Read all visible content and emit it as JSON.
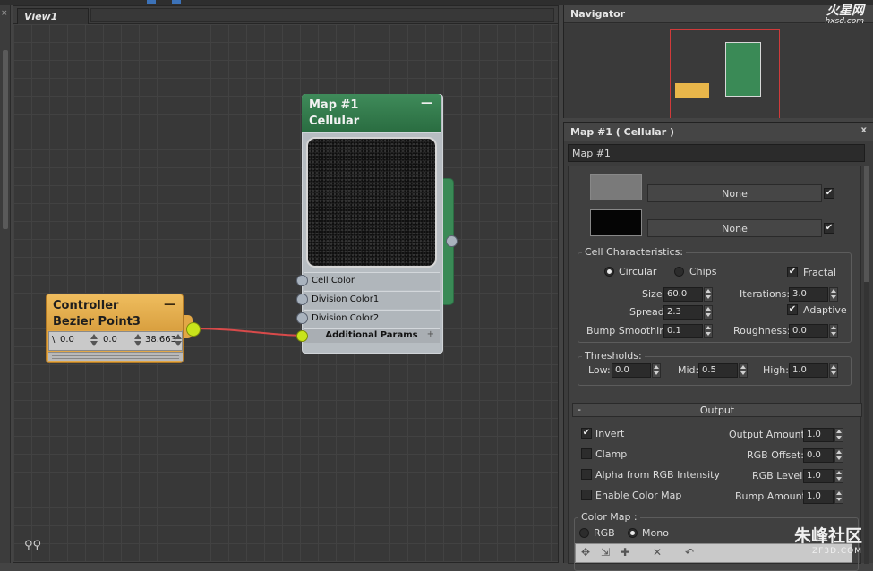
{
  "viewport": {
    "tab_label": "View1"
  },
  "controller_node": {
    "title_line1": "Controller",
    "title_line2": "Bezier Point3",
    "minimize": "—",
    "values": [
      "0.0",
      "0.0",
      "38.663"
    ]
  },
  "map_node": {
    "title_line1": "Map #1",
    "title_line2": "Cellular",
    "minimize": "—",
    "inputs": [
      "Cell Color",
      "Division Color1",
      "Division Color2",
      "Additional Params"
    ],
    "expand": "+"
  },
  "navigator": {
    "title": "Navigator"
  },
  "watermark_top": {
    "brand": "火星网",
    "url": "hxsd.com"
  },
  "properties": {
    "title": "Map #1  ( Cellular )",
    "close": "x",
    "name_value": "Map #1",
    "color_rows": [
      {
        "swatch": "#7a7a7a",
        "button": "None",
        "checked": true
      },
      {
        "swatch": "#050505",
        "button": "None",
        "checked": true
      }
    ],
    "cell_characteristics": {
      "group_label": "Cell Characteristics:",
      "radio_circular": "Circular",
      "radio_chips": "Chips",
      "selected": "Circular",
      "fractal_label": "Fractal",
      "fractal_checked": true,
      "size_label": "Size:",
      "size_value": "60.0",
      "spread_label": "Spread:",
      "spread_value": "2.3",
      "bump_smoothing_label": "Bump Smoothing:",
      "bump_smoothing_value": "0.1",
      "iterations_label": "Iterations:",
      "iterations_value": "3.0",
      "adaptive_label": "Adaptive",
      "adaptive_checked": true,
      "roughness_label": "Roughness:",
      "roughness_value": "0.0"
    },
    "thresholds": {
      "group_label": "Thresholds:",
      "low_label": "Low:",
      "low_value": "0.0",
      "mid_label": "Mid:",
      "mid_value": "0.5",
      "high_label": "High:",
      "high_value": "1.0"
    },
    "output": {
      "header": "Output",
      "collapse": "-",
      "invert_label": "Invert",
      "invert_checked": true,
      "clamp_label": "Clamp",
      "clamp_checked": false,
      "alpha_label": "Alpha from RGB Intensity",
      "alpha_checked": false,
      "enable_color_map_label": "Enable Color Map",
      "enable_color_map_checked": false,
      "output_amount_label": "Output Amount:",
      "output_amount_value": "1.0",
      "rgb_offset_label": "RGB Offset:",
      "rgb_offset_value": "0.0",
      "rgb_level_label": "RGB Level:",
      "rgb_level_value": "1.0",
      "bump_amount_label": "Bump Amount:",
      "bump_amount_value": "1.0",
      "color_map_label": "Color Map :",
      "rgb_label": "RGB",
      "mono_label": "Mono",
      "color_map_selected": "Mono"
    }
  },
  "watermark_bottom": {
    "brand": "朱峰社区",
    "url": "ZF3D.COM"
  },
  "colors": {
    "controller": "#e2a746",
    "map_header": "#2f7548",
    "wire": "#d84a4a",
    "socket_active": "#c8e41b"
  }
}
